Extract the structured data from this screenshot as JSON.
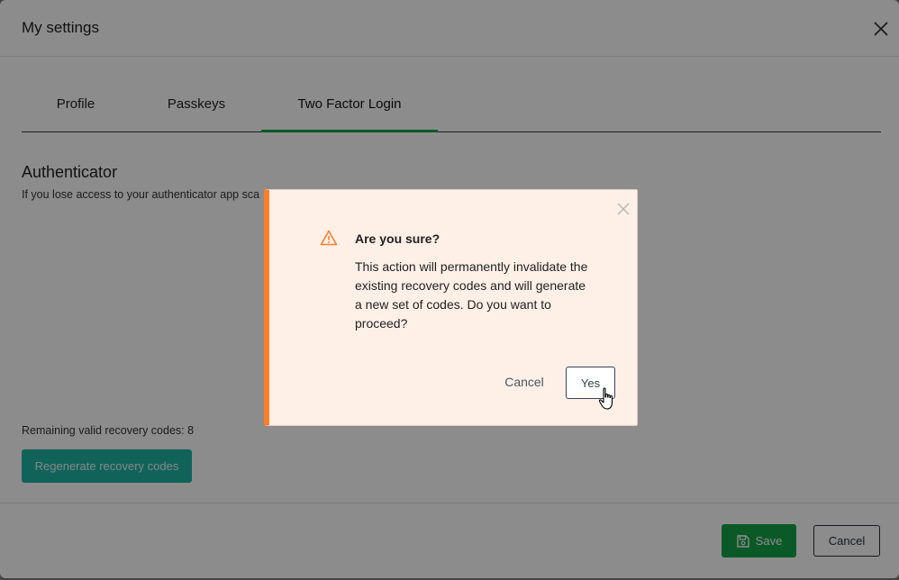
{
  "window": {
    "title": "My settings"
  },
  "tabs": [
    {
      "label": "Profile"
    },
    {
      "label": "Passkeys"
    },
    {
      "label": "Two Factor Login",
      "active": true
    }
  ],
  "authenticator": {
    "title": "Authenticator",
    "description": "If you lose access to your authenticator app sca",
    "remaining_text": "Remaining valid recovery codes: 8",
    "regenerate_label": "Regenerate recovery codes"
  },
  "footer": {
    "save_label": "Save",
    "cancel_label": "Cancel"
  },
  "dialog": {
    "title": "Are you sure?",
    "body": "This action will permanently invalidate the existing recovery codes and will generate a new set of codes. Do you want to proceed?",
    "cancel_label": "Cancel",
    "yes_label": "Yes"
  },
  "icons": {
    "close": "close-icon",
    "warning": "warning-icon",
    "save": "save-icon",
    "cursor": "hand-pointer-icon"
  },
  "colors": {
    "accent_green": "#16a34a",
    "teal_button": "#1fb5a5",
    "warning_orange": "#f97f2a",
    "dialog_bg": "#fef0e7"
  }
}
